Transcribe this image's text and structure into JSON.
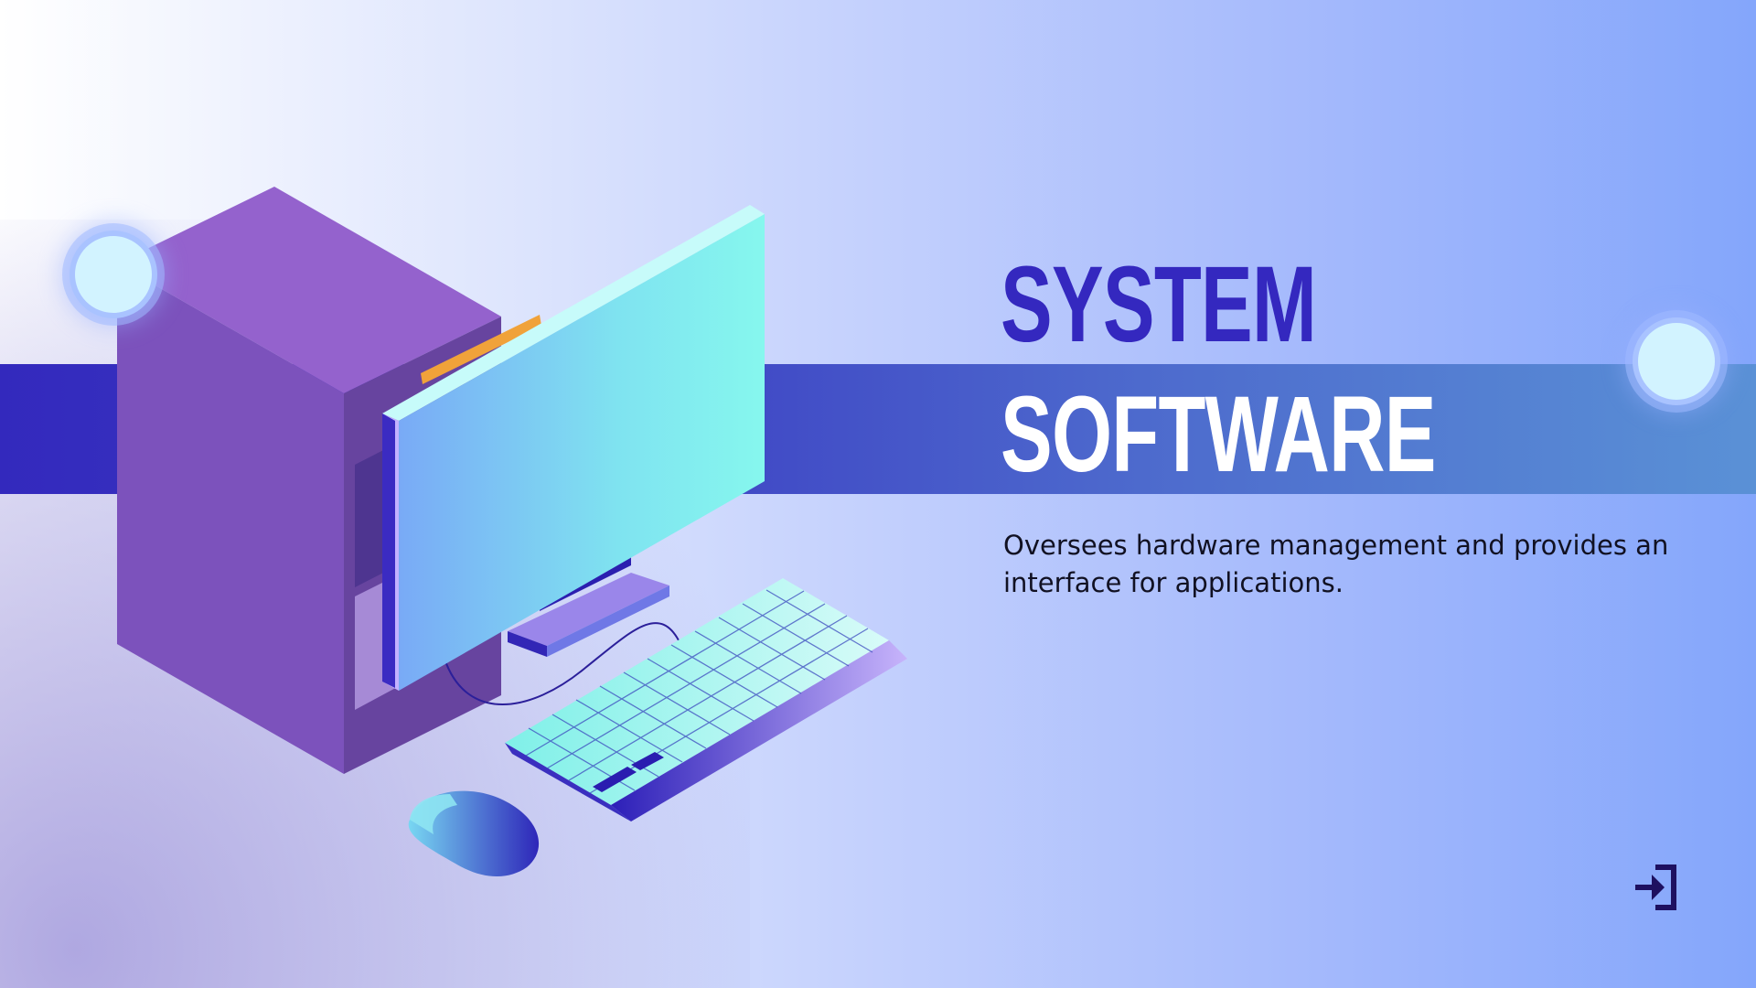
{
  "slide": {
    "title_line1": "SYSTEM",
    "title_line2": "SOFTWARE",
    "description": "Oversees hardware management and provides an interface for applications."
  },
  "illustration": {
    "subject": "isometric desktop computer with tower, monitor, keyboard and mouse",
    "colors": {
      "tower": "#7a52bd",
      "monitor": "#7ff0ee",
      "keyboard": "#a8f6ef",
      "accent": "#3428bf"
    }
  },
  "controls": {
    "exit_icon": "exit-arrow-icon"
  },
  "colors": {
    "band": "#3d40c4",
    "title_primary": "#3428bf",
    "title_secondary": "#ffffff",
    "text": "#111122"
  }
}
